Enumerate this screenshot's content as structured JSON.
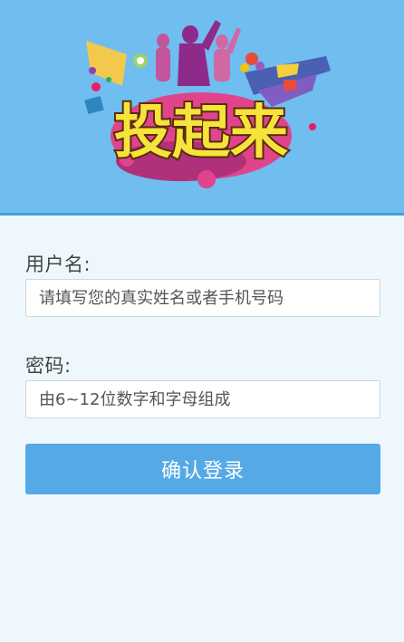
{
  "banner": {
    "logo_text": "投起来",
    "bg_color": "#70bdf0"
  },
  "form": {
    "username_label": "用户名:",
    "username_placeholder": "请填写您的真实姓名或者手机号码",
    "password_label": "密码:",
    "password_placeholder": "由6~12位数字和字母组成",
    "submit_label": "确认登录",
    "accent_color": "#55aae6"
  }
}
